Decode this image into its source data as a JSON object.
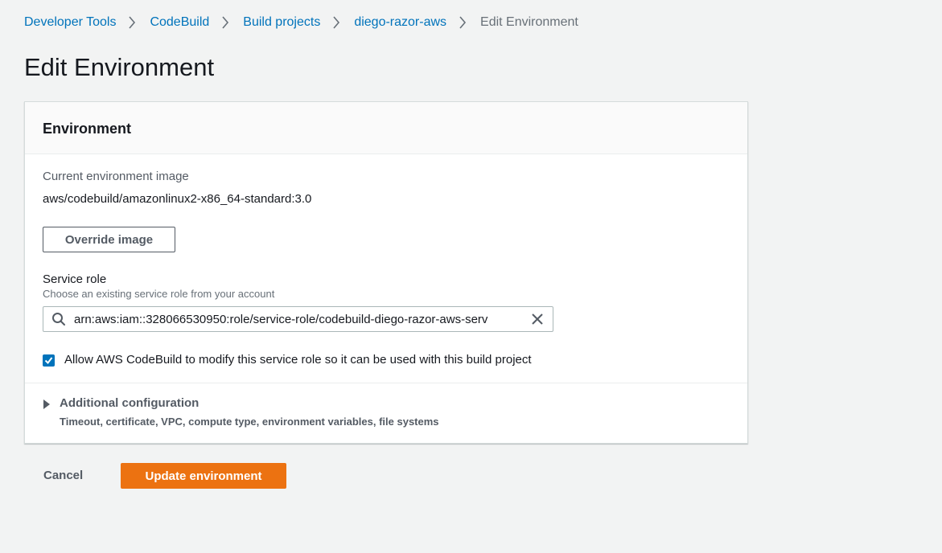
{
  "breadcrumb": {
    "items": [
      "Developer Tools",
      "CodeBuild",
      "Build projects",
      "diego-razor-aws"
    ],
    "current": "Edit Environment"
  },
  "page": {
    "title": "Edit Environment"
  },
  "environment_panel": {
    "title": "Environment",
    "current_image_label": "Current environment image",
    "current_image_value": "aws/codebuild/amazonlinux2-x86_64-standard:3.0",
    "override_button_label": "Override image",
    "service_role": {
      "label": "Service role",
      "description": "Choose an existing service role from your account",
      "value": "arn:aws:iam::328066530950:role/service-role/codebuild-diego-razor-aws-serv"
    },
    "allow_modify": {
      "checked": true,
      "label": "Allow AWS CodeBuild to modify this service role so it can be used with this build project"
    },
    "additional_config": {
      "title": "Additional configuration",
      "description": "Timeout, certificate, VPC, compute type, environment variables, file systems"
    }
  },
  "actions": {
    "cancel_label": "Cancel",
    "submit_label": "Update environment"
  },
  "colors": {
    "link": "#0073bb",
    "primary": "#ec7211",
    "background": "#f2f3f3"
  },
  "icons": {
    "breadcrumb_separator": "chevron-right-icon",
    "search": "search-icon",
    "clear": "close-icon",
    "checkbox": "check-icon",
    "expander": "caret-right-icon"
  }
}
